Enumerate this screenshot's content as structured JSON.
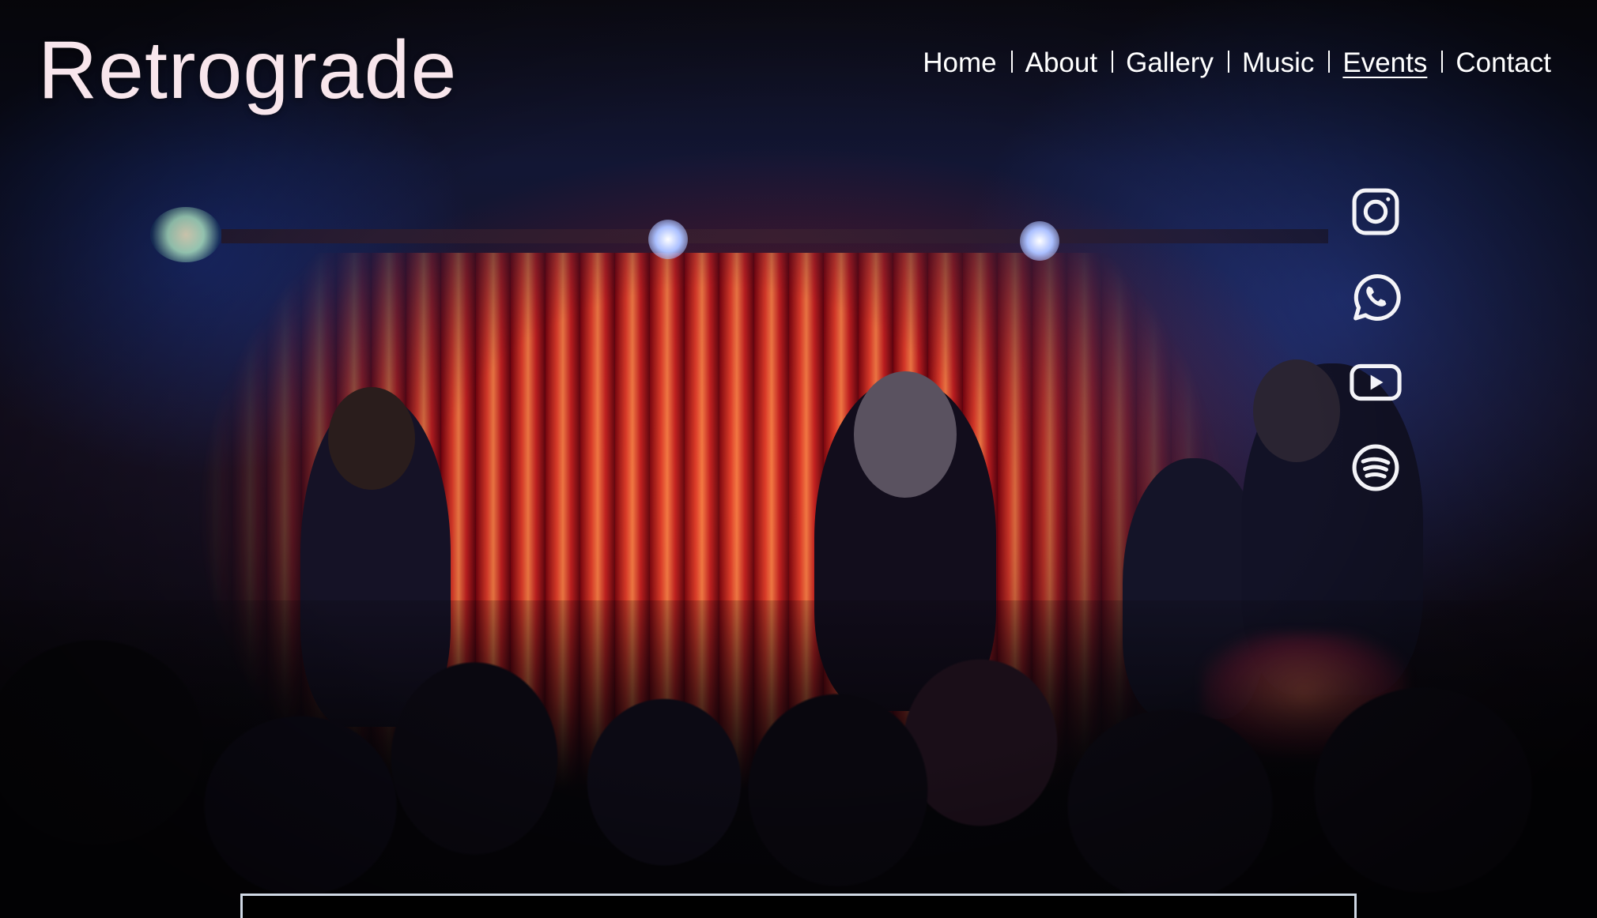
{
  "brand": {
    "name": "Retrograde"
  },
  "nav": {
    "items": [
      {
        "label": "Home",
        "active": false
      },
      {
        "label": "About",
        "active": false
      },
      {
        "label": "Gallery",
        "active": false
      },
      {
        "label": "Music",
        "active": false
      },
      {
        "label": "Events",
        "active": true
      },
      {
        "label": "Contact",
        "active": false
      }
    ]
  },
  "social": {
    "icons": [
      "instagram-icon",
      "whatsapp-icon",
      "youtube-icon",
      "spotify-icon"
    ],
    "icon_color": "#f4f4f8"
  },
  "hero": {
    "image": "live-band-on-stage-photo",
    "accent_colors": [
      "#e8302c",
      "#2a4bb0",
      "#ff8a5a"
    ]
  }
}
